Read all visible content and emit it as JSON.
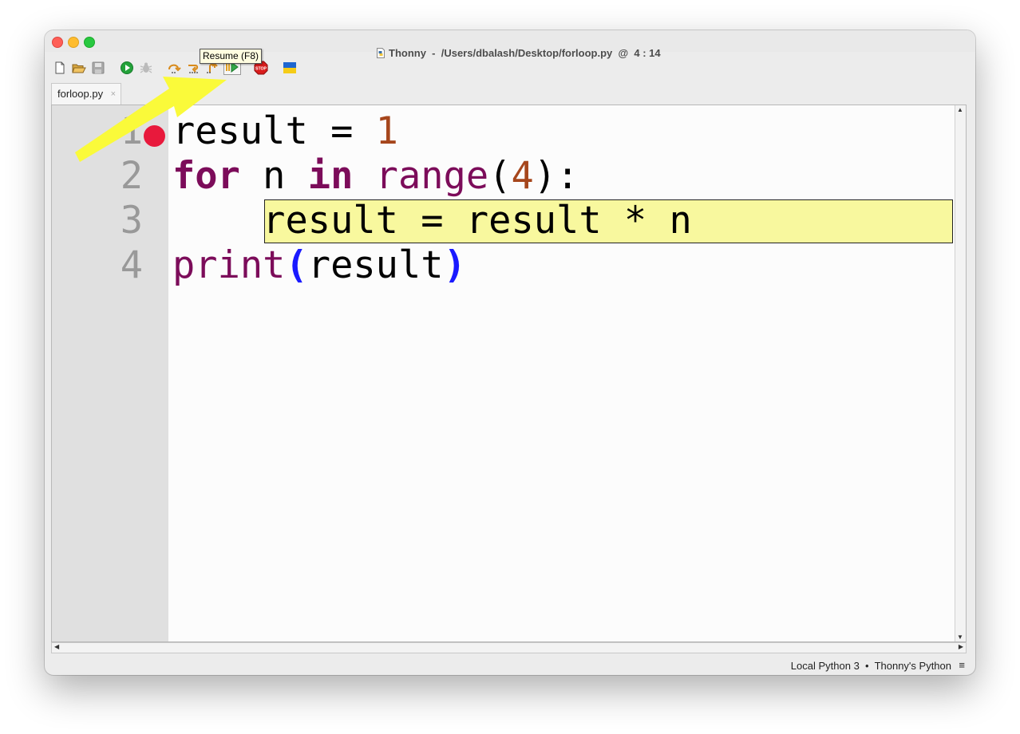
{
  "window": {
    "title": "Thonny  -  /Users/dbalash/Desktop/forloop.py  @  4 : 14"
  },
  "toolbar": {
    "buttons": [
      {
        "name": "new-file-icon"
      },
      {
        "name": "open-file-icon"
      },
      {
        "name": "save-file-icon"
      },
      {
        "name": "run-icon"
      },
      {
        "name": "debug-icon"
      },
      {
        "name": "step-over-icon"
      },
      {
        "name": "step-into-icon"
      },
      {
        "name": "step-out-icon"
      },
      {
        "name": "resume-icon"
      },
      {
        "name": "stop-icon"
      },
      {
        "name": "ukraine-flag-icon"
      }
    ],
    "stop_label": "STOP",
    "tooltip": "Resume (F8)"
  },
  "tabs": [
    {
      "label": "forloop.py",
      "close": "×"
    }
  ],
  "editor": {
    "line_numbers": [
      "1",
      "2",
      "3",
      "4"
    ],
    "breakpoint_line": 1,
    "current_line": 3,
    "lines": [
      [
        {
          "t": "result = ",
          "c": ""
        },
        {
          "t": "1",
          "c": "num"
        }
      ],
      [
        {
          "t": "for",
          "c": "kw"
        },
        {
          "t": " n ",
          "c": ""
        },
        {
          "t": "in",
          "c": "kw"
        },
        {
          "t": " ",
          "c": ""
        },
        {
          "t": "range",
          "c": "bi"
        },
        {
          "t": "(",
          "c": ""
        },
        {
          "t": "4",
          "c": "num"
        },
        {
          "t": "):",
          "c": ""
        }
      ],
      [
        {
          "t": "    result = result * n",
          "c": ""
        }
      ],
      [
        {
          "t": "print",
          "c": "bi"
        },
        {
          "t": "(",
          "c": "par"
        },
        {
          "t": "result",
          "c": ""
        },
        {
          "t": ")",
          "c": "par"
        }
      ]
    ]
  },
  "statusbar": {
    "interpreter": "Local Python 3  •  Thonny's Python",
    "menu_glyph": "≡"
  },
  "colors": {
    "keyword": "#7c0c5a",
    "number": "#a6461c",
    "paren": "#1a1aff",
    "highlight": "#f8f89e",
    "breakpoint": "#e8193c",
    "annotation_arrow": "#fafa3a"
  }
}
